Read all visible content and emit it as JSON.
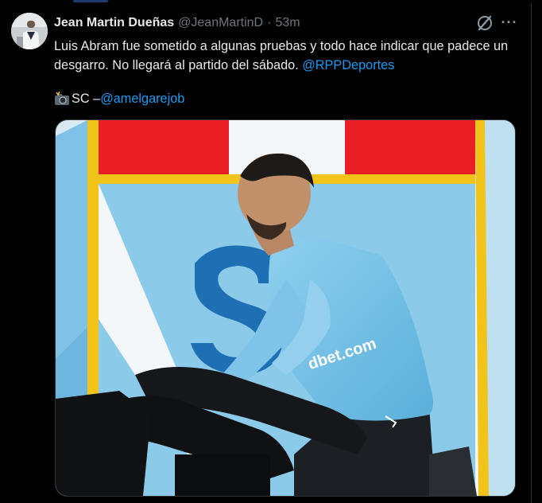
{
  "tweet": {
    "author_name": "Jean Martin Dueñas",
    "author_handle": "@JeanMartinD",
    "separator": "·",
    "time": "53m",
    "more_label": "···",
    "text_part1": "Luis Abram fue sometido a algunas pruebas y todo hace indicar que padece un desgarro. No llegará al partido del sábado. ",
    "text_mention": "@RPPDeportes",
    "credit_prefix": "SC – ",
    "credit_mention": "@amelgarejob",
    "photo_text": "dbet.com"
  },
  "icons": {
    "avatar": "author-avatar",
    "grok": "grok-icon",
    "more": "more-icon",
    "camera": "camera-flash-emoji"
  },
  "colors": {
    "background": "#000000",
    "text": "#e7e9ea",
    "muted": "#71767b",
    "link": "#1d9bf0"
  }
}
